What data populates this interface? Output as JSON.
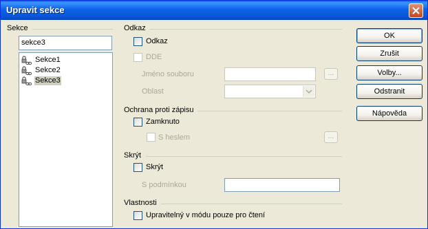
{
  "window": {
    "title": "Upravit sekce"
  },
  "sections": {
    "header": "Sekce",
    "name_value": "sekce3",
    "items": [
      {
        "label": "Sekce1"
      },
      {
        "label": "Sekce2"
      },
      {
        "label": "Sekce3",
        "selected": true
      }
    ]
  },
  "link": {
    "header": "Odkaz",
    "checkbox_label": "Odkaz",
    "dde_label": "DDE",
    "filename_label": "Jméno souboru",
    "filename_value": "",
    "browse_label": "...",
    "area_label": "Oblast",
    "area_value": ""
  },
  "protection": {
    "header": "Ochrana proti zápisu",
    "locked_label": "Zamknuto",
    "password_label": "S heslem",
    "password_button": "..."
  },
  "hide": {
    "header": "Skrýt",
    "hide_label": "Skrýt",
    "condition_label": "S podmínkou",
    "condition_value": ""
  },
  "properties": {
    "header": "Vlastnosti",
    "editable_label": "Upravitelný v módu pouze pro čtení"
  },
  "buttons": {
    "ok": "OK",
    "cancel": "Zrušit",
    "options": "Volby...",
    "remove": "Odstranit",
    "help": "Nápověda"
  }
}
